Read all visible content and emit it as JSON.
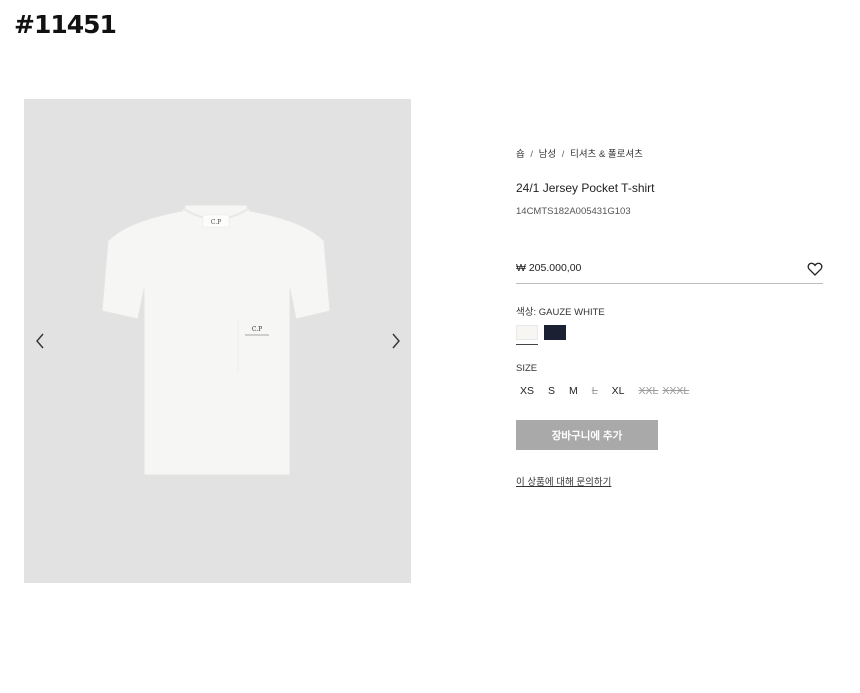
{
  "page_id": "#11451",
  "gallery": {
    "prev_icon": "chevron-left-icon",
    "next_icon": "chevron-right-icon",
    "logo_text": "C.P"
  },
  "breadcrumb": {
    "home": "숍",
    "separator": "/",
    "category": "남성",
    "subcategory": "티셔츠 & 폴로셔츠"
  },
  "product": {
    "title": "24/1 Jersey Pocket T-shirt",
    "code": "14CMTS182A005431G103",
    "price": "₩ 205.000,00",
    "wishlist_icon": "heart-icon"
  },
  "color": {
    "label_prefix": "색상:",
    "selected": "GAUZE WHITE",
    "swatches": [
      {
        "name": "GAUZE WHITE",
        "hex": "#f7f6f2",
        "selected": true
      },
      {
        "name": "navy",
        "hex": "#1c2033",
        "selected": false
      }
    ]
  },
  "size": {
    "label": "SIZE",
    "options": [
      {
        "label": "XS",
        "available": true
      },
      {
        "label": "S",
        "available": true
      },
      {
        "label": "M",
        "available": true
      },
      {
        "label": "L",
        "available": false
      },
      {
        "label": "XL",
        "available": true
      },
      {
        "label": "XXL",
        "available": false
      },
      {
        "label": "XXXL",
        "available": false
      }
    ]
  },
  "actions": {
    "add_to_cart": "장바구니에 추가",
    "inquiry": "이 상품에 대해 문의하기"
  }
}
